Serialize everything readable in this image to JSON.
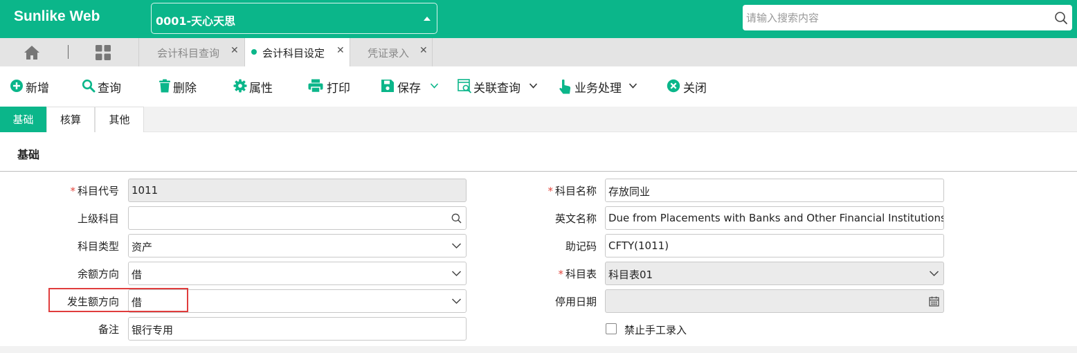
{
  "app": {
    "logo": "Sunlike Web",
    "company": "0001-天心天思"
  },
  "search": {
    "placeholder": "请输入搜索内容"
  },
  "tabs": [
    {
      "label": "会计科目查询",
      "active": false
    },
    {
      "label": "会计科目设定",
      "active": true
    },
    {
      "label": "凭证录入",
      "active": false
    }
  ],
  "toolbar": {
    "new": "新增",
    "query": "查询",
    "delete": "删除",
    "properties": "属性",
    "print": "打印",
    "save": "保存",
    "related_query": "关联查询",
    "business": "业务处理",
    "close": "关闭"
  },
  "subtabs": [
    {
      "label": "基础",
      "active": true
    },
    {
      "label": "核算",
      "active": false
    },
    {
      "label": "其他",
      "active": false
    }
  ],
  "section": {
    "title": "基础"
  },
  "form": {
    "subject_code": {
      "label": "科目代号",
      "value": "1011",
      "required": true
    },
    "parent_subject": {
      "label": "上级科目",
      "value": ""
    },
    "subject_type": {
      "label": "科目类型",
      "value": "资产"
    },
    "balance_direction": {
      "label": "余额方向",
      "value": "借"
    },
    "occurrence_direction": {
      "label": "发生额方向",
      "value": "借"
    },
    "remark": {
      "label": "备注",
      "value": "银行专用"
    },
    "subject_name": {
      "label": "科目名称",
      "value": "存放同业",
      "required": true
    },
    "english_name": {
      "label": "英文名称",
      "value": "Due from Placements with Banks and Other Financial Institutions"
    },
    "mnemonic": {
      "label": "助记码",
      "value": "CFTY(1011)"
    },
    "subject_table": {
      "label": "科目表",
      "value": "科目表01",
      "required": true
    },
    "disable_date": {
      "label": "停用日期",
      "value": ""
    },
    "disable_manual_entry": {
      "label": "禁止手工录入",
      "checked": false
    }
  },
  "colors": {
    "brand": "#0bb68a",
    "required": "#e2463d",
    "highlight": "#e03c3c"
  }
}
